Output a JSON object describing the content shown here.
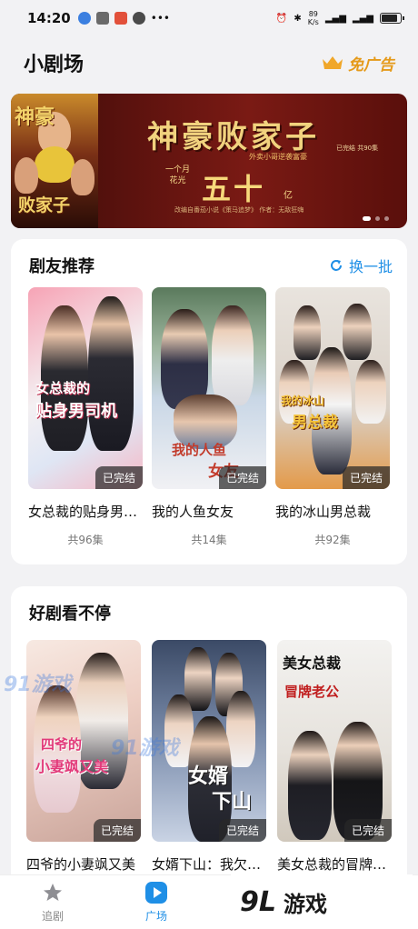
{
  "status_bar": {
    "time": "14:20",
    "net_speed_value": "89",
    "net_speed_unit": "K/s",
    "battery_level": 0.85
  },
  "header": {
    "title": "小剧场",
    "ad_free_label": "免广告"
  },
  "banner": {
    "poster_top": "神豪",
    "poster_bottom": "败家子",
    "title": "神豪败家子",
    "subtitle": "外卖小哥逆袭富豪",
    "status": "已完结 共90集",
    "phrase_line1": "一个月",
    "phrase_line2": "花光",
    "big_text": "五十",
    "unit": "亿",
    "credit": "改编自番茄小说《策马追梦》 作者：无敌狂嗨"
  },
  "recommend": {
    "title": "剧友推荐",
    "refresh_label": "换一批",
    "items": [
      {
        "cover_text_1": "女总裁的",
        "cover_text_2": "贴身男司机",
        "badge": "已完结",
        "title": "女总裁的贴身男司机",
        "count": "共96集"
      },
      {
        "cover_text_1": "我的人鱼",
        "cover_text_2": "女友",
        "badge": "已完结",
        "title": "我的人鱼女友",
        "count": "共14集"
      },
      {
        "cover_text_1": "我的冰山",
        "cover_text_2": "男总裁",
        "badge": "已完结",
        "title": "我的冰山男总裁",
        "count": "共92集"
      }
    ]
  },
  "binge": {
    "title": "好剧看不停",
    "items": [
      {
        "cover_text_1": "四爷的",
        "cover_text_2": "小妻飒又美",
        "badge": "已完结",
        "title": "四爷的小妻飒又美"
      },
      {
        "cover_text_1": "女婿",
        "cover_text_2": "下山",
        "badge": "已完结",
        "title": "女婿下山：我欠你的"
      },
      {
        "cover_text_1": "美女总裁",
        "cover_text_2": "冒牌老公",
        "badge": "已完结",
        "title": "美女总裁的冒牌老公"
      }
    ]
  },
  "bottom_nav": {
    "items": [
      {
        "label": "追剧",
        "icon": "star-icon"
      },
      {
        "label": "广场",
        "icon": "play-icon"
      }
    ]
  },
  "watermark": {
    "logo": "9L",
    "text": "游戏",
    "faint": "91游戏"
  },
  "colors": {
    "accent": "#1f8fe6",
    "gold": "#e59a1a",
    "banner_bg": "#5b120e"
  }
}
